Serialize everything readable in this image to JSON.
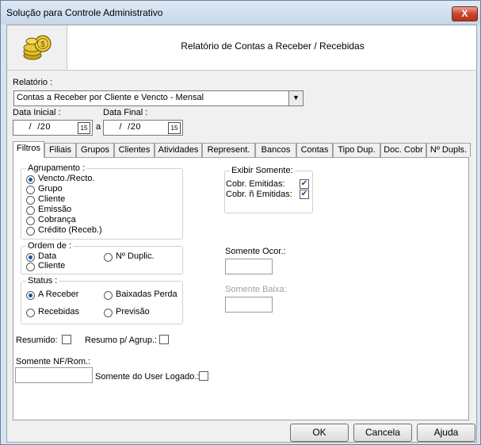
{
  "window": {
    "title": "Solução para Controle Administrativo",
    "close_glyph": "X"
  },
  "header": {
    "report_title": "Relatório de Contas a Receber / Recebidas",
    "logo_icon": "coins-icon"
  },
  "report": {
    "label": "Relatório :",
    "selected": "Contas a Receber por Cliente e Vencto - Mensal"
  },
  "dates": {
    "initial_label": "Data Inicial :",
    "final_label": "Data Final :",
    "initial_value": " /  /20",
    "final_value": " /  /20",
    "separator": "a",
    "calendar_glyph": "15"
  },
  "tabs": [
    "Filtros",
    "Filiais",
    "Grupos",
    "Clientes",
    "Atividades",
    "Represent.",
    "Bancos",
    "Contas",
    "Tipo Dup.",
    "Doc. Cobr",
    "Nº Dupls."
  ],
  "agrupamento": {
    "title": "Agrupamento :",
    "options": [
      "Vencto./Recto.",
      "Grupo",
      "Cliente",
      "Emissão",
      "Cobrança",
      "Crédito (Receb.)"
    ],
    "selected_index": 0
  },
  "ordem": {
    "title": "Ordem de :",
    "options": [
      "Data",
      "Cliente",
      "Nº Duplic."
    ],
    "selected_index": 0
  },
  "status": {
    "title": "Status :",
    "options": [
      "A Receber",
      "Baixadas Perda",
      "Recebidas",
      "Previsão"
    ],
    "selected_index": 0
  },
  "resumido": {
    "label": "Resumido:",
    "checked": false
  },
  "resumo_agrup": {
    "label": "Resumo p/ Agrup.:",
    "checked": false
  },
  "somente_nf": {
    "label": "Somente NF/Rom.:",
    "value": ""
  },
  "somente_user": {
    "label": "Somente do User Logado.:",
    "checked": false
  },
  "exibir": {
    "title": "Exibir Somente:",
    "options": [
      {
        "label": "Cobr. Emitidas:",
        "checked": true
      },
      {
        "label": "Cobr. ñ Emitidas:",
        "checked": true
      }
    ]
  },
  "somente_ocor": {
    "label": "Somente Ocor.:",
    "value": ""
  },
  "somente_baixa": {
    "label": "Somente Baixa:",
    "value": ""
  },
  "buttons": {
    "ok": "OK",
    "cancel": "Cancela",
    "help": "Ajuda"
  }
}
